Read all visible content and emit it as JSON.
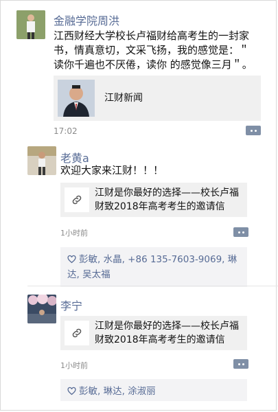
{
  "posts": [
    {
      "name": "金融学院周洪",
      "text": "江西财经大学校长卢福财给高考生的一封家书，情真意切，文采飞扬，我的感觉是：＂读你千遍也不厌倦，读你 的感觉像三月＂。",
      "card_title": "江财新闻",
      "time": "17:02"
    },
    {
      "name": "老黄a",
      "text": "欢迎大家来江财！！！",
      "card_title": "江财是你最好的选择——校长卢福财致2018年高考考生的邀请信",
      "time": "1小时前",
      "likes": "彭敏, 水晶, +86 135-7603-9069, 琳达, 吴太福"
    },
    {
      "name": "李宁",
      "card_title": "江财是你最好的选择——校长卢福财致2018年高考考生的邀请信",
      "time": "1小时前",
      "likes": "彭敏, 琳达, 涂淑丽"
    }
  ]
}
